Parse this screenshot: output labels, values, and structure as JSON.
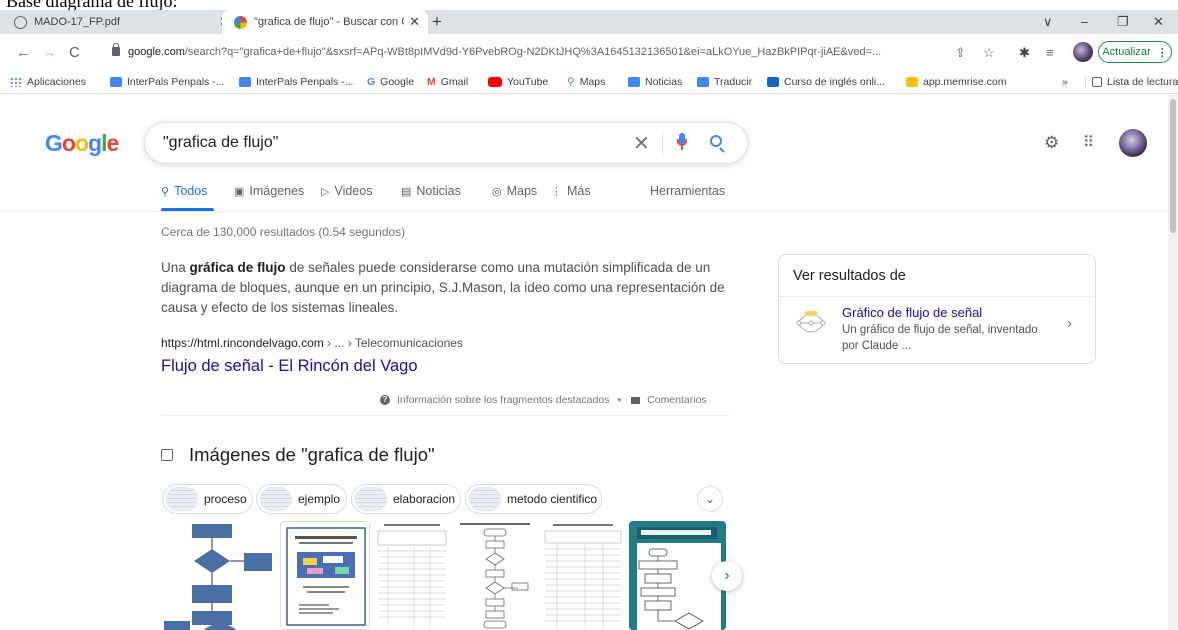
{
  "cropped_heading": "Base diagrama de flujo:",
  "browser": {
    "tabs": [
      {
        "label": "MADO-17_FP.pdf",
        "active": false
      },
      {
        "label": "\"grafica de flujo\" - Buscar con Go",
        "active": true
      }
    ],
    "new_tab": "+",
    "window_controls": [
      "∨",
      "–",
      "❐",
      "✕"
    ],
    "url_domain": "google.com",
    "url_rest": "/search?q=\"grafica+de+flujo\"&sxsrf=APq-WBt8pIMVd9d-Y6PvebROg-N2DKtJHQ%3A1645132136501&ei=aLkOYue_HazBkPIPqr-jiAE&ved=...",
    "update_label": "Actualizar",
    "bookmarks": [
      {
        "label": "Aplicaciones",
        "icon": "apps-grid-icon",
        "color": "#1a73e8"
      },
      {
        "label": "InterPals Penpals -...",
        "icon": "mail-icon",
        "color": "#4285f4"
      },
      {
        "label": "InterPals Penpals -...",
        "icon": "mail-icon",
        "color": "#4285f4"
      },
      {
        "label": "Google",
        "icon": "google-icon",
        "color": "#4285f4"
      },
      {
        "label": "Gmail",
        "icon": "gmail-icon",
        "color": "#ea4335"
      },
      {
        "label": "YouTube",
        "icon": "youtube-icon",
        "color": "#ff0000"
      },
      {
        "label": "Maps",
        "icon": "maps-pin-icon",
        "color": "#34a853"
      },
      {
        "label": "Noticias",
        "icon": "news-icon",
        "color": "#4285f4"
      },
      {
        "label": "Traducir",
        "icon": "translate-icon",
        "color": "#4285f4"
      },
      {
        "label": "Curso de inglés onli...",
        "icon": "course-icon",
        "color": "#1565c0"
      },
      {
        "label": "app.memrise.com",
        "icon": "memrise-icon",
        "color": "#ffc107"
      }
    ],
    "bookmarks_more": "»",
    "reading_list": "Lista de lectura"
  },
  "google": {
    "logo_letters": [
      {
        "ch": "G",
        "color": "#4285f4"
      },
      {
        "ch": "o",
        "color": "#ea4335"
      },
      {
        "ch": "o",
        "color": "#fbbc05"
      },
      {
        "ch": "g",
        "color": "#4285f4"
      },
      {
        "ch": "l",
        "color": "#34a853"
      },
      {
        "ch": "e",
        "color": "#ea4335"
      }
    ],
    "query": "\"grafica de flujo\"",
    "tabs": [
      {
        "label": "Todos",
        "icon": "search-icon",
        "active": true
      },
      {
        "label": "Imágenes",
        "icon": "image-icon",
        "active": false
      },
      {
        "label": "Videos",
        "icon": "play-icon",
        "active": false
      },
      {
        "label": "Noticias",
        "icon": "news-icon",
        "active": false
      },
      {
        "label": "Maps",
        "icon": "map-pin-icon",
        "active": false
      },
      {
        "label": "Más",
        "icon": "more-vert-icon",
        "active": false
      }
    ],
    "tools": "Herramientas",
    "stats": "Cerca de 130,000 resultados (0.54 segundos)"
  },
  "snippet": {
    "pre": "Una ",
    "bold": "gráfica de flujo",
    "post": " de señales puede considerarse como una mutación simplificada de un diagrama de bloques, aunque en un principio, S.J.Mason, la ideo como una representación de causa y efecto de los sistemas lineales.",
    "cite_site": "https://html.rincondelvago.com",
    "cite_crumb": " › ... › Telecomunicaciones",
    "title": "Flujo de señal - El Rincón del Vago",
    "about": "Información sobre los fragmentos destacados",
    "dot": "•",
    "feedback": "Comentarios"
  },
  "images": {
    "heading": "Imágenes de \"grafica de flujo\"",
    "chips": [
      "proceso",
      "ejemplo",
      "elaboracion",
      "metodo cientifico"
    ]
  },
  "panel": {
    "heading": "Ver resultados de",
    "title": "Gráfico de flujo de señal",
    "desc": "Un gráfico de flujo de señal, inventado por Claude ..."
  }
}
